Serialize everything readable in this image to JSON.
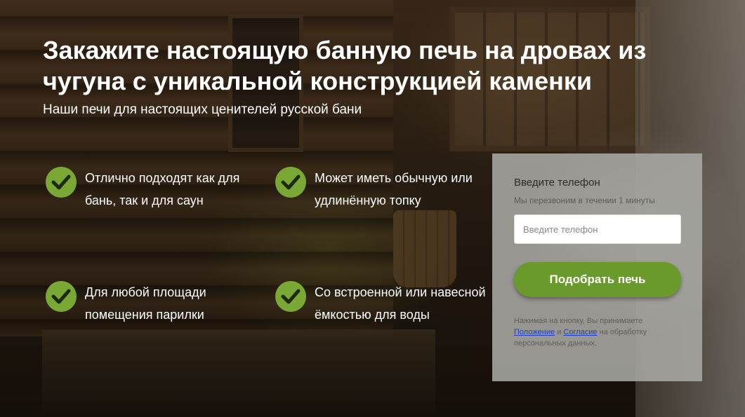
{
  "header": {
    "title": "Закажите настоящую банную печь на дровах из чугуна с уникальной конструкцией каменки",
    "subtitle": "Наши печи для настоящих ценителей русской бани"
  },
  "features": [
    {
      "icon": "check-circle-icon",
      "text": "Отлично подходят как для бань, так и для саун"
    },
    {
      "icon": "check-circle-icon",
      "text": "Может иметь обычную или удлинённую топку"
    },
    {
      "icon": "check-circle-icon",
      "text": "Для любой площади помещения парилки"
    },
    {
      "icon": "check-circle-icon",
      "text": "Со встроенной или навесной ёмкостью для воды"
    }
  ],
  "form": {
    "heading": "Введите телефон",
    "subheading": "Мы перезвоним в течении 1 минуты",
    "phone_placeholder": "Введите телефон",
    "phone_value": "",
    "submit_label": "Подобрать печь",
    "legal_prefix": "Нажимая на кнопку, Вы принимаете",
    "link_terms": "Положение",
    "legal_and": "и",
    "link_consent": "Согласие",
    "legal_suffix": "на обработку персональных данных."
  },
  "colors": {
    "accent_green": "#6a9a2b",
    "check_green": "#7aa834",
    "link_blue": "#1f3fcf"
  }
}
